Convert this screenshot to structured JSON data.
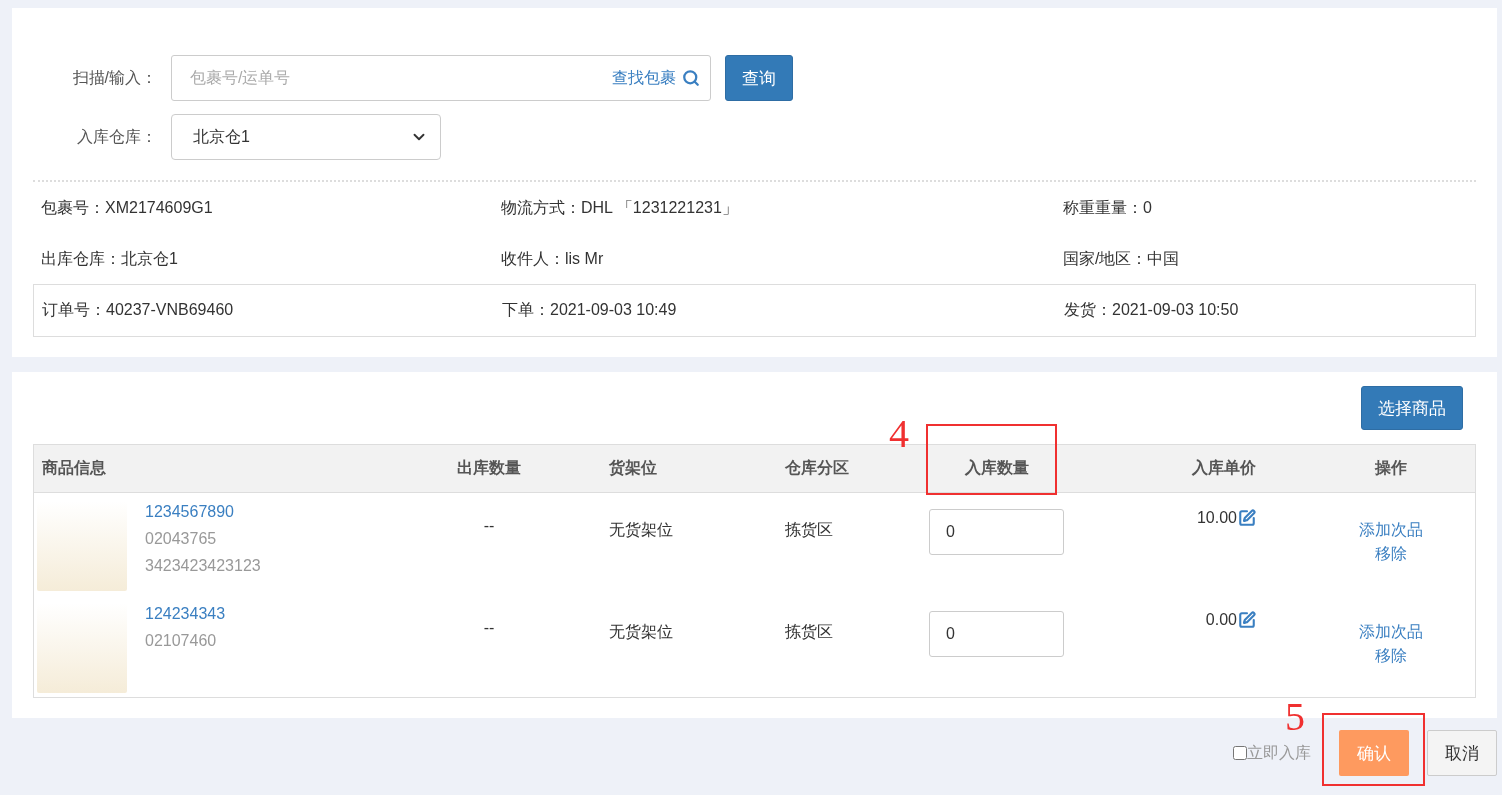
{
  "search": {
    "label": "扫描/输入：",
    "placeholder": "包裹号/运单号",
    "find_link": "查找包裹",
    "button": "查询"
  },
  "warehouse": {
    "label": "入库仓库：",
    "value": "北京仓1"
  },
  "info": [
    {
      "label": "包裹号：",
      "value": "XM2174609G1"
    },
    {
      "label": "物流方式：",
      "value": "DHL 「1231221231」"
    },
    {
      "label": "称重重量：",
      "value": "0"
    },
    {
      "label": "出库仓库：",
      "value": "北京仓1"
    },
    {
      "label": "收件人：",
      "value": "lis Mr"
    },
    {
      "label": "国家/地区：",
      "value": "中国"
    }
  ],
  "order_info": [
    {
      "label": "订单号：",
      "value": "40237-VNB69460"
    },
    {
      "label": "下单：",
      "value": "2021-09-03 10:49"
    },
    {
      "label": "发货：",
      "value": "2021-09-03 10:50"
    }
  ],
  "select_button": "选择商品",
  "table": {
    "columns": [
      "商品信息",
      "出库数量",
      "货架位",
      "仓库分区",
      "入库数量",
      "入库单价",
      "操作"
    ],
    "rows": [
      {
        "sku": "1234567890",
        "codes": [
          "02043765",
          "3423423423123"
        ],
        "out_qty": "--",
        "shelf": "无货架位",
        "zone": "拣货区",
        "in_qty": "0",
        "price": "10.00",
        "actions": [
          "添加次品",
          "移除"
        ]
      },
      {
        "sku": "124234343",
        "codes": [
          "02107460"
        ],
        "out_qty": "--",
        "shelf": "无货架位",
        "zone": "拣货区",
        "in_qty": "0",
        "price": "0.00",
        "actions": [
          "添加次品",
          "移除"
        ]
      }
    ]
  },
  "footer": {
    "checkbox": {
      "label": "立即入库",
      "checked": false
    },
    "confirm": "确认",
    "cancel": "取消"
  },
  "annotations": [
    {
      "number": "4"
    },
    {
      "number": "5"
    }
  ]
}
